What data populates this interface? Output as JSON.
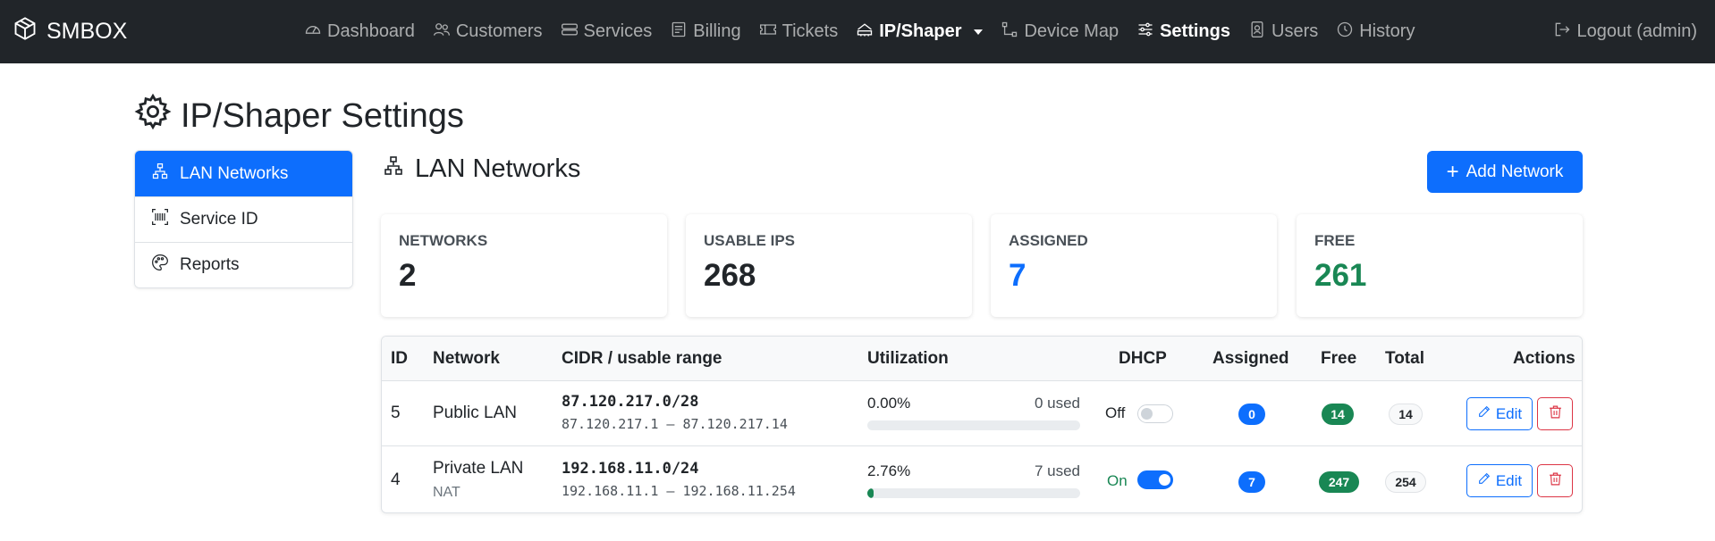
{
  "navbar": {
    "brand": "SMBOX",
    "items": [
      {
        "label": "Dashboard",
        "icon": "speedometer-icon"
      },
      {
        "label": "Customers",
        "icon": "people-icon"
      },
      {
        "label": "Services",
        "icon": "hdd-stack-icon"
      },
      {
        "label": "Billing",
        "icon": "receipt-icon"
      },
      {
        "label": "Tickets",
        "icon": "ticket-icon"
      },
      {
        "label": "IP/Shaper",
        "icon": "network-icon",
        "active_dropdown": true
      },
      {
        "label": "Device Map",
        "icon": "diagram-icon"
      },
      {
        "label": "Settings",
        "icon": "sliders-icon",
        "active": true
      },
      {
        "label": "Users",
        "icon": "person-badge-icon"
      },
      {
        "label": "History",
        "icon": "clock-history-icon"
      }
    ],
    "logout": "Logout (admin)"
  },
  "page_title": "IP/Shaper Settings",
  "sidebar": {
    "items": [
      {
        "label": "LAN Networks",
        "active": true
      },
      {
        "label": "Service ID"
      },
      {
        "label": "Reports"
      }
    ]
  },
  "section": {
    "title": "LAN Networks",
    "add_button": "Add Network"
  },
  "stats": [
    {
      "label": "NETWORKS",
      "value": "2"
    },
    {
      "label": "USABLE IPS",
      "value": "268"
    },
    {
      "label": "ASSIGNED",
      "value": "7"
    },
    {
      "label": "FREE",
      "value": "261"
    }
  ],
  "table": {
    "headers": [
      "ID",
      "Network",
      "CIDR / usable range",
      "Utilization",
      "DHCP",
      "Assigned",
      "Free",
      "Total",
      "Actions"
    ],
    "rows": [
      {
        "id": "5",
        "network": "Public LAN",
        "sub": "",
        "cidr": "87.120.217.0/28",
        "range": "87.120.217.1 – 87.120.217.14",
        "util_pct": "0.00%",
        "util_used": "0 used",
        "util_fraction": 0.0,
        "dhcp": "Off",
        "dhcp_on": false,
        "assigned": "0",
        "free": "14",
        "total": "14",
        "edit": "Edit"
      },
      {
        "id": "4",
        "network": "Private LAN",
        "sub": "NAT",
        "cidr": "192.168.11.0/24",
        "range": "192.168.11.1 – 192.168.11.254",
        "util_pct": "2.76%",
        "util_used": "7 used",
        "util_fraction": 0.0276,
        "dhcp": "On",
        "dhcp_on": true,
        "assigned": "7",
        "free": "247",
        "total": "254",
        "edit": "Edit"
      }
    ]
  },
  "colors": {
    "navbar_bg": "#212529",
    "primary": "#0d6efd",
    "success": "#198754",
    "danger": "#dc3545"
  }
}
